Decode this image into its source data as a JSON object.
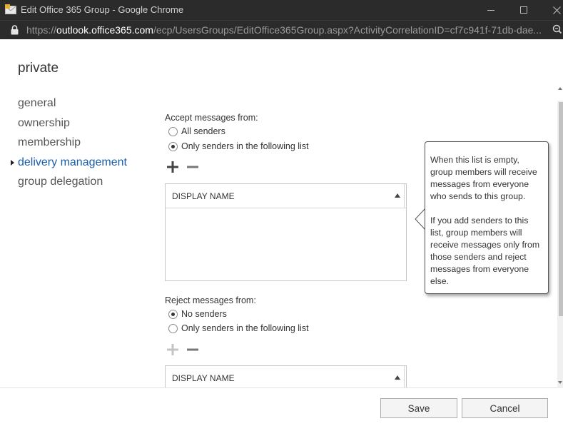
{
  "window": {
    "title": "Edit Office 365 Group - Google Chrome",
    "url_scheme": "https://",
    "url_host": "outlook.office365.com",
    "url_path": "/ecp/UsersGroups/EditOffice365Group.aspx?ActivityCorrelationID=cf7c941f-71db-dae..."
  },
  "page": {
    "title": "private"
  },
  "nav": {
    "items": [
      {
        "label": "general",
        "active": false
      },
      {
        "label": "ownership",
        "active": false
      },
      {
        "label": "membership",
        "active": false
      },
      {
        "label": "delivery management",
        "active": true
      },
      {
        "label": "group delegation",
        "active": false
      }
    ]
  },
  "accept": {
    "label": "Accept messages from:",
    "option_all": "All senders",
    "option_list": "Only senders in the following list",
    "selected": "list",
    "column_header": "DISPLAY NAME"
  },
  "reject": {
    "label": "Reject messages from:",
    "option_none": "No senders",
    "option_list": "Only senders in the following list",
    "selected": "none",
    "column_header": "DISPLAY NAME"
  },
  "callout": {
    "para1": "When this list is empty, group members will receive messages from everyone who sends to this group.",
    "para2": "If you add senders to this list, group members will receive messages only from those senders and reject messages from everyone else."
  },
  "buttons": {
    "save": "Save",
    "cancel": "Cancel"
  },
  "colors": {
    "titlebar": "#2b2b2b",
    "nav_active": "#1a5ea8"
  }
}
